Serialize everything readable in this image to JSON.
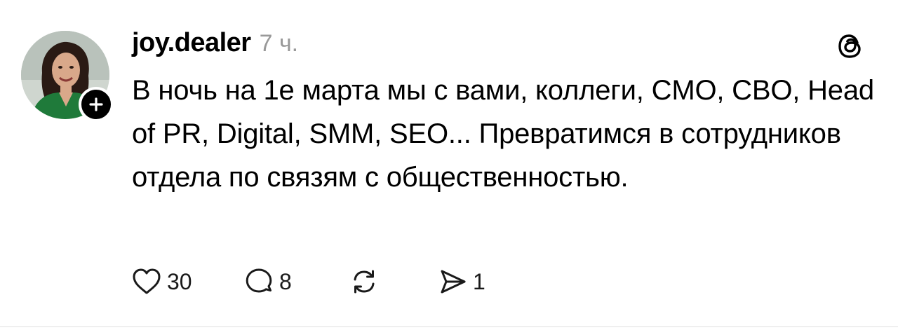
{
  "post": {
    "author": {
      "username": "joy.dealer",
      "avatar_icon": "profile-photo",
      "follow_icon": "plus-icon"
    },
    "timestamp": "7 ч.",
    "text": "В ночь на 1е марта мы с вами, коллеги, CMO, CBO, Head of PR, Digital, SMM, SEO... Превратимся в сотрудников отдела по связям с общественностью.",
    "app_icon": "threads-logo-icon",
    "actions": {
      "like": {
        "icon": "heart-icon",
        "count": "30"
      },
      "reply": {
        "icon": "comment-icon",
        "count": "8"
      },
      "repost": {
        "icon": "repost-icon"
      },
      "share": {
        "icon": "send-icon",
        "count": "1"
      }
    }
  },
  "colors": {
    "text": "#000000",
    "muted": "#999999",
    "badge": "#000000",
    "divider": "#e0e0e0"
  }
}
